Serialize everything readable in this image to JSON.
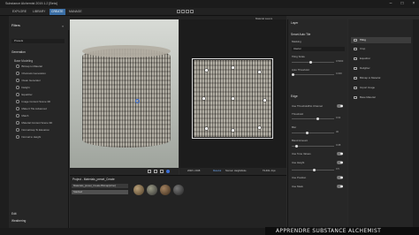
{
  "window": {
    "title": "Substance Alchemist 2019.1.2 [Beta]"
  },
  "menu": {
    "items": [
      "EXPLORE",
      "LIBRARY",
      "CREATE",
      "MANAGE"
    ],
    "active_index": 2
  },
  "left": {
    "heading": "Filters",
    "crumb": "Presets",
    "section": "Generation",
    "group": "Base Modeling",
    "items": [
      "Bitmap to Material",
      "Channels Generation",
      "Clean Generator",
      "Delight",
      "Equalizer",
      "Image Content Scene 3D",
      "Make It Tile Advanced",
      "Match",
      "Material Content Scene 3D",
      "Normalmap To Elevation",
      "Normal to Height"
    ],
    "sections_bottom": [
      "Edit",
      "Weathering"
    ]
  },
  "viewport": {
    "labels_right": [
      "Material Layers"
    ],
    "bar2d": [
      "2048 x 2048",
      "Material",
      "Normal",
      "Height/Hole",
      "TILING: 4/px"
    ]
  },
  "graph": {
    "title": "Project - Materials_preset_Create",
    "node1": "Materials_preset_Create Bitmap(inher)",
    "node2": "Stacked"
  },
  "right": {
    "title": "Layer",
    "section1": "Smart Auto Tile",
    "labels": [
      "Masking",
      "Mode",
      "Tiling Scale",
      "Auto Threshold",
      "Edge",
      "Use Threshold/No Channel",
      "Threshold",
      "Blur",
      "Blend Amount",
      "Use Tone Values",
      "Use Height",
      "Use Position",
      "Use Mask"
    ],
    "mode_value": "Interior",
    "values": [
      "0.5000",
      "0.000",
      "0.64",
      "30",
      "0.08",
      "0.5"
    ]
  },
  "filters": {
    "items": [
      "Tiling",
      "Crop",
      "Equalizer",
      "Delighter",
      "Bitmap to Material",
      "Import Image",
      "Base Material"
    ],
    "selected_index": 0
  },
  "banner": {
    "text": "APPRENDRE SUBSTANCE ALCHEMIST"
  }
}
